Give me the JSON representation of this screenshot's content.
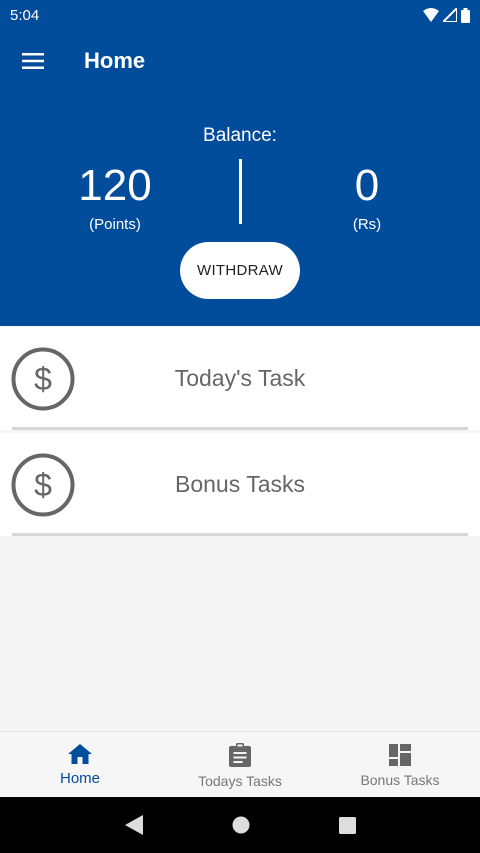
{
  "status_bar": {
    "time": "5:04",
    "icons": [
      "wifi-icon",
      "signal-icon",
      "battery-icon"
    ]
  },
  "app_bar": {
    "title": "Home",
    "menu_icon": "hamburger-menu-icon"
  },
  "balance": {
    "label": "Balance:",
    "points_value": "120",
    "points_unit": "(Points)",
    "rs_value": "0",
    "rs_unit": "(Rs)",
    "withdraw_label": "WITHDRAW"
  },
  "tasks": [
    {
      "label": "Today's Task",
      "icon": "dollar-circle-icon"
    },
    {
      "label": "Bonus Tasks",
      "icon": "dollar-circle-icon"
    }
  ],
  "bottom_nav": [
    {
      "label": "Home",
      "icon": "home-icon",
      "active": true
    },
    {
      "label": "Todays Tasks",
      "icon": "clipboard-icon",
      "active": false
    },
    {
      "label": "Bonus Tasks",
      "icon": "dashboard-icon",
      "active": false
    }
  ],
  "colors": {
    "primary": "#024c9c",
    "background": "#f5f5f5",
    "card": "#ffffff",
    "icon_gray": "#666666",
    "nav_inactive": "#777777"
  }
}
